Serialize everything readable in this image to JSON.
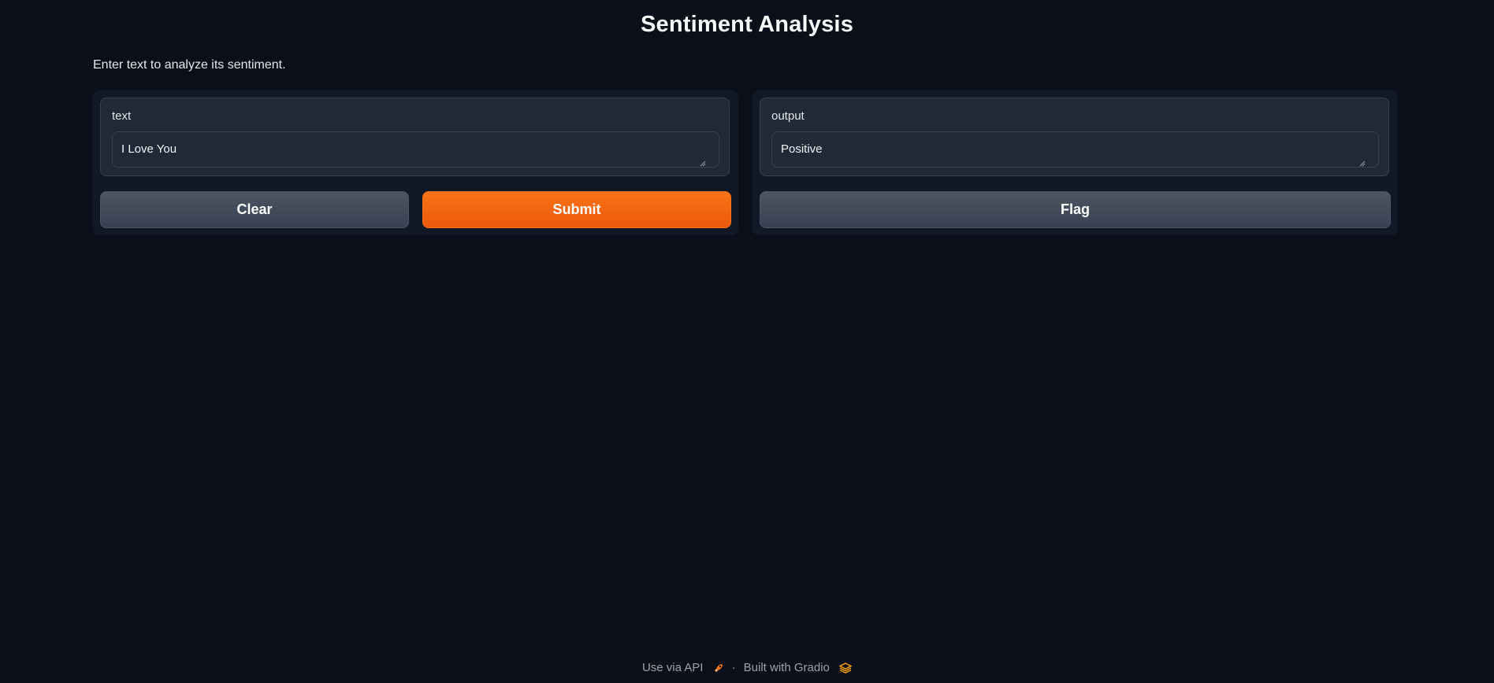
{
  "app": {
    "title": "Sentiment Analysis",
    "description": "Enter text to analyze its sentiment."
  },
  "input_panel": {
    "label": "text",
    "value": "I Love You",
    "clear_label": "Clear",
    "submit_label": "Submit"
  },
  "output_panel": {
    "label": "output",
    "value": "Positive",
    "flag_label": "Flag"
  },
  "footer": {
    "api_label": "Use via API",
    "api_icon": "rocket-icon",
    "separator": "·",
    "built_label": "Built with Gradio",
    "built_icon": "gradio-logo-icon"
  },
  "colors": {
    "background": "#0b0f19",
    "panel": "#111827",
    "block": "#1f2937",
    "border": "#374151",
    "primary": "#f97316",
    "secondary": "#4b5563"
  }
}
